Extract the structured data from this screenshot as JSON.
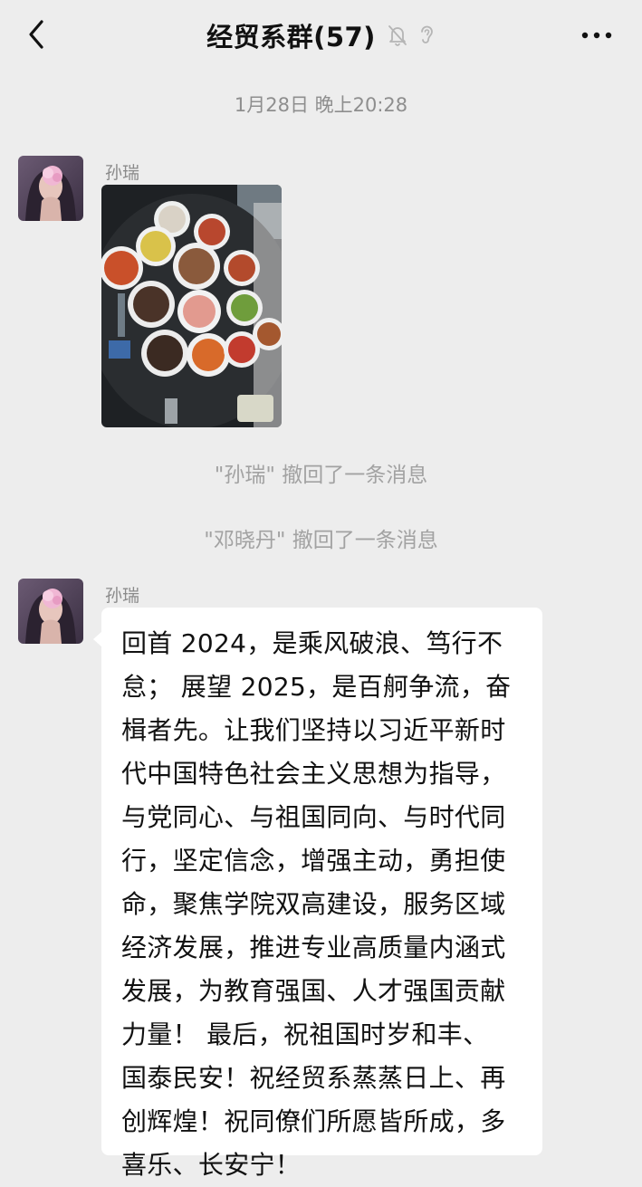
{
  "header": {
    "title": "经贸系群(57)",
    "back_icon": "chevron-left-icon",
    "mute_icon": "bell-off-icon",
    "ear_icon": "ear-icon",
    "more_icon": "more-horizontal-icon"
  },
  "chat": {
    "timestamp": "1月28日 晚上20:28",
    "messages": [
      {
        "sender": "孙瑞",
        "type": "image",
        "image_icon": "food-photo"
      },
      {
        "type": "system",
        "text": "\"孙瑞\" 撤回了一条消息"
      },
      {
        "type": "system",
        "text": "\"邓晓丹\" 撤回了一条消息"
      },
      {
        "sender": "孙瑞",
        "type": "text",
        "text": "回首 2024，是乘风破浪、笃行不\n怠； 展望 2025，是百舸争流，奋\n楫者先。让我们坚持以习近平新时\n代中国特色社会主义思想为指导，\n与党同心、与祖国同向、与时代同\n行，坚定信念，增强主动，勇担使\n命，聚焦学院双高建设，服务区域\n经济发展，推进专业高质量内涵式\n发展，为教育强国、人才强国贡献\n力量！ 最后，祝祖国时岁和丰、\n国泰民安！祝经贸系蒸蒸日上、再\n创辉煌！祝同僚们所愿皆所成，多\n喜乐、长安宁！"
      }
    ]
  },
  "colors": {
    "background": "#ededed",
    "bubble": "#ffffff",
    "system_text": "#a2a2a2"
  }
}
